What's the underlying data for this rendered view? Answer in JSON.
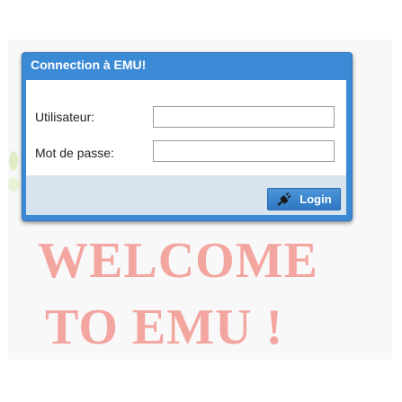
{
  "login": {
    "title": "Connection à EMU!",
    "username_label": "Utilisateur:",
    "username_value": "",
    "password_label": "Mot de passe:",
    "password_value": "",
    "login_button": "Login",
    "button_icon": "plug-icon"
  },
  "welcome": {
    "line1": "WELCOME",
    "line2": "TO EMU !"
  },
  "colors": {
    "dialog_accent": "#3b8ad6",
    "button": "#3a86cf",
    "welcome_text": "#f3a5a0"
  }
}
